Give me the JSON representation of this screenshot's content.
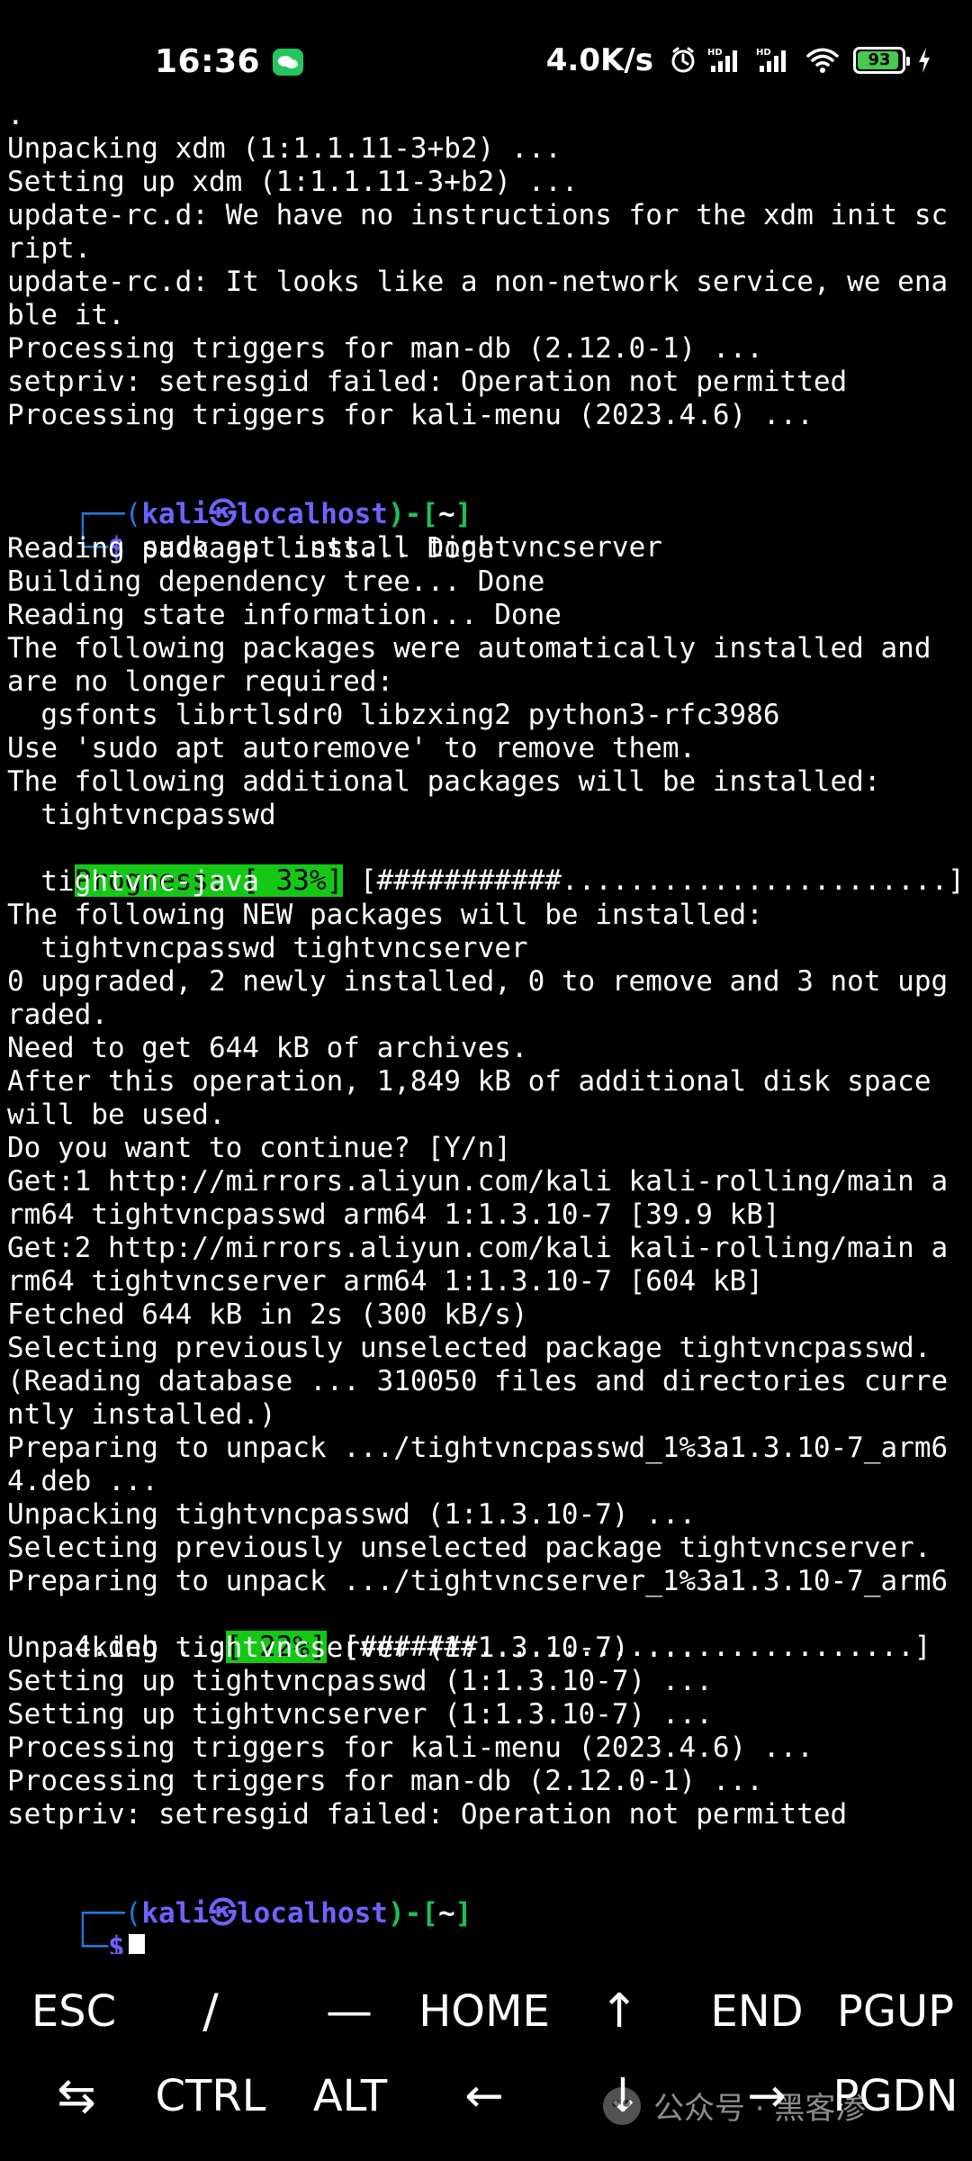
{
  "status_bar": {
    "time": "16:36",
    "network_speed": "4.0K/s",
    "battery_level": "93",
    "battery_percent": 93,
    "battery_color": "#46c94e",
    "icons": [
      "wechat-icon",
      "alarm-icon",
      "signal-hd-icon",
      "signal-hd-icon",
      "wifi-icon",
      "battery-icon",
      "charging-icon"
    ]
  },
  "terminal": {
    "colors": {
      "prompt_box": "#1f7ad8",
      "prompt_user": "#6f63ff",
      "prompt_bracket": "#16c45a",
      "progress_bg": "#14c815"
    },
    "lines": [
      ".",
      "Unpacking xdm (1:1.1.11-3+b2) ...",
      "Setting up xdm (1:1.1.11-3+b2) ...",
      "update-rc.d: We have no instructions for the xdm init sc",
      "ript.",
      "update-rc.d: It looks like a non-network service, we ena",
      "ble it.",
      "Processing triggers for man-db (2.12.0-1) ...",
      "setpriv: setresgid failed: Operation not permitted",
      "Processing triggers for kali-menu (2023.4.6) ...",
      "",
      "",
      "",
      "Reading package lists... Done",
      "Building dependency tree... Done",
      "Reading state information... Done",
      "The following packages were automatically installed and",
      "are no longer required:",
      "  gsfonts librtlsdr0 libzxing2 python3-rfc3986",
      "Use 'sudo apt autoremove' to remove them.",
      "The following additional packages will be installed:",
      "  tightvncpasswd",
      "",
      "  tightvnc-java",
      "The following NEW packages will be installed:",
      "  tightvncpasswd tightvncserver",
      "0 upgraded, 2 newly installed, 0 to remove and 3 not upg",
      "raded.",
      "Need to get 644 kB of archives.",
      "After this operation, 1,849 kB of additional disk space",
      "will be used.",
      "Do you want to continue? [Y/n]",
      "Get:1 http://mirrors.aliyun.com/kali kali-rolling/main a",
      "rm64 tightvncpasswd arm64 1:1.3.10-7 [39.9 kB]",
      "Get:2 http://mirrors.aliyun.com/kali kali-rolling/main a",
      "rm64 tightvncserver arm64 1:1.3.10-7 [604 kB]",
      "Fetched 644 kB in 2s (300 kB/s)",
      "Selecting previously unselected package tightvncpasswd.",
      "(Reading database ... 310050 files and directories curre",
      "ntly installed.)",
      "Preparing to unpack .../tightvncpasswd_1%3a1.3.10-7_arm6",
      "",
      "Unpacking tightvncpasswd (1:1.3.10-7) ...",
      "Selecting previously unselected package tightvncserver.",
      "Preparing to unpack .../tightvncserver_1%3a1.3.10-7_arm6",
      "",
      "Unpacking tightvncserver (1:1.3.10-7) ...",
      "Setting up tightvncpasswd (1:1.3.10-7) ...",
      "Setting up tightvncserver (1:1.3.10-7) ...",
      "Processing triggers for kali-menu (2023.4.6) ...",
      "Processing triggers for man-db (2.12.0-1) ...",
      "setpriv: setresgid failed: Operation not permitted"
    ],
    "prompt1": {
      "prefix": "┌──(",
      "user": "kali㉿localhost",
      "suffix": ")-[",
      "path": "~",
      "end": "]",
      "second_prefix": "└─",
      "dollar": "$",
      "command": " sudo apt install tightvncserver"
    },
    "progress1": {
      "label": "Progress: [ 33%]",
      "percent": 33,
      "bar": " [###########.......................]"
    },
    "deb_line": "4.deb ...",
    "progress2": {
      "label": "[ 22%]",
      "percent": 22,
      "bar": " [#######..........................]"
    },
    "prompt2": {
      "prefix": "┌──(",
      "user": "kali㉿localhost",
      "suffix": ")-[",
      "path": "~",
      "end": "]",
      "second_prefix": "└─",
      "dollar": "$"
    }
  },
  "extra_keys": {
    "row1": [
      "ESC",
      "/",
      "—",
      "HOME",
      "↑",
      "END",
      "PGUP"
    ],
    "row2": [
      "⇆",
      "CTRL",
      "ALT",
      "←",
      "↓",
      "→",
      "PGDN"
    ]
  },
  "watermark": {
    "text": "公众号 · 黑客渗",
    "icon": "wechat-watermark-icon"
  }
}
